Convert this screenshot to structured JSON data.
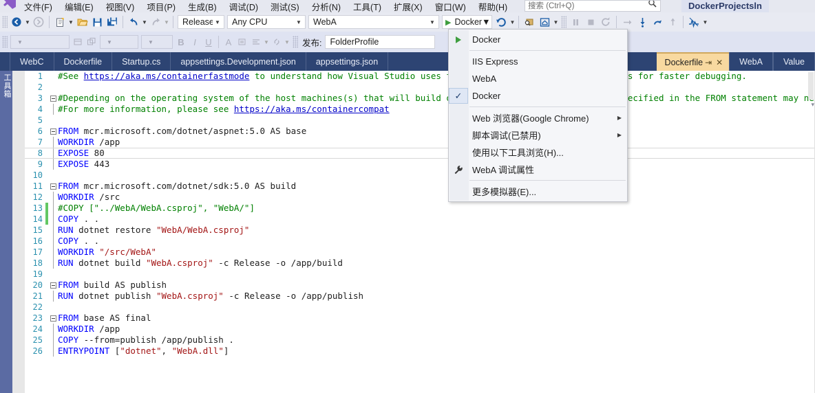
{
  "menubar": {
    "items": [
      {
        "label": "文件(F)"
      },
      {
        "label": "编辑(E)"
      },
      {
        "label": "视图(V)"
      },
      {
        "label": "项目(P)"
      },
      {
        "label": "生成(B)"
      },
      {
        "label": "调试(D)"
      },
      {
        "label": "测试(S)"
      },
      {
        "label": "分析(N)"
      },
      {
        "label": "工具(T)"
      },
      {
        "label": "扩展(X)"
      },
      {
        "label": "窗口(W)"
      },
      {
        "label": "帮助(H)"
      }
    ],
    "search_placeholder": "搜索 (Ctrl+Q)",
    "solution_title": "DockerProjectsln"
  },
  "toolbar": {
    "configuration": "Release",
    "platform": "Any CPU",
    "startup_project": "WebA",
    "run_target": "Docker",
    "publish_label": "发布:",
    "publish_profile": "FolderProfile"
  },
  "tabs": {
    "left": [
      {
        "label": "WebC"
      },
      {
        "label": "Dockerfile"
      },
      {
        "label": "Startup.cs"
      },
      {
        "label": "appsettings.Development.json"
      },
      {
        "label": "appsettings.json"
      }
    ],
    "right": [
      {
        "label": "Dockerfile",
        "active": true
      },
      {
        "label": "WebA",
        "active": false
      },
      {
        "label": "Value",
        "active": false
      }
    ],
    "pin_icon": "pin-icon",
    "close_icon": "close-icon"
  },
  "toolbox_rail_label": "工具箱",
  "dropdown": {
    "items": [
      {
        "label": "Docker",
        "icon": "play-icon",
        "type": "item"
      },
      {
        "type": "separator"
      },
      {
        "label": "IIS Express",
        "icon": "",
        "type": "item"
      },
      {
        "label": "WebA",
        "icon": "",
        "type": "item"
      },
      {
        "label": "Docker",
        "icon": "check-icon",
        "type": "item",
        "checked": true
      },
      {
        "type": "separator"
      },
      {
        "label": "Web 浏览器(Google Chrome)",
        "icon": "",
        "type": "item",
        "submenu": true
      },
      {
        "label": "脚本调试(已禁用)",
        "icon": "",
        "type": "item",
        "submenu": true
      },
      {
        "label": "使用以下工具浏览(H)...",
        "icon": "",
        "type": "item"
      },
      {
        "label": "WebA 调试属性",
        "icon": "wrench-icon",
        "type": "item"
      },
      {
        "type": "separator"
      },
      {
        "label": "更多模拟器(E)...",
        "icon": "",
        "type": "item"
      }
    ]
  },
  "editor": {
    "filename": "Dockerfile",
    "lines": [
      {
        "n": 1,
        "fold": "none",
        "change": "",
        "current": false,
        "spans": [
          {
            "t": "#See ",
            "c": "c-comment"
          },
          {
            "t": "https://aka.ms/containerfastmode",
            "c": "c-link"
          },
          {
            "t": " to understand how Visual Studio uses this Dockerfile to build your images for faster debugging.",
            "c": "c-comment"
          }
        ]
      },
      {
        "n": 2,
        "fold": "none",
        "change": "",
        "current": false,
        "spans": []
      },
      {
        "n": 3,
        "fold": "open",
        "change": "",
        "current": false,
        "spans": [
          {
            "t": "#Depending on the operating system of the host machines(s) that will build or run the containers, the image specified in the FROM statement may need to be changed.",
            "c": "c-comment"
          }
        ]
      },
      {
        "n": 4,
        "fold": "bar",
        "change": "",
        "current": false,
        "spans": [
          {
            "t": "#For more information, please see ",
            "c": "c-comment"
          },
          {
            "t": "https://aka.ms/containercompat",
            "c": "c-link"
          }
        ]
      },
      {
        "n": 5,
        "fold": "none",
        "change": "",
        "current": false,
        "spans": []
      },
      {
        "n": 6,
        "fold": "open",
        "change": "",
        "current": false,
        "spans": [
          {
            "t": "FROM",
            "c": "c-kw"
          },
          {
            "t": " mcr.microsoft.com/dotnet/aspnet:5.0 AS base",
            "c": "c-plain"
          }
        ]
      },
      {
        "n": 7,
        "fold": "bar",
        "change": "",
        "current": false,
        "spans": [
          {
            "t": "WORKDIR",
            "c": "c-kw"
          },
          {
            "t": " /app",
            "c": "c-plain"
          }
        ]
      },
      {
        "n": 8,
        "fold": "bar",
        "change": "",
        "current": true,
        "spans": [
          {
            "t": "EXPOSE",
            "c": "c-kw"
          },
          {
            "t": " 80",
            "c": "c-plain"
          }
        ]
      },
      {
        "n": 9,
        "fold": "bar",
        "change": "",
        "current": false,
        "spans": [
          {
            "t": "EXPOSE",
            "c": "c-kw"
          },
          {
            "t": " 443",
            "c": "c-plain"
          }
        ]
      },
      {
        "n": 10,
        "fold": "none",
        "change": "",
        "current": false,
        "spans": []
      },
      {
        "n": 11,
        "fold": "open",
        "change": "",
        "current": false,
        "spans": [
          {
            "t": "FROM",
            "c": "c-kw"
          },
          {
            "t": " mcr.microsoft.com/dotnet/sdk:5.0 AS build",
            "c": "c-plain"
          }
        ]
      },
      {
        "n": 12,
        "fold": "bar",
        "change": "",
        "current": false,
        "spans": [
          {
            "t": "WORKDIR",
            "c": "c-kw"
          },
          {
            "t": " /src",
            "c": "c-plain"
          }
        ]
      },
      {
        "n": 13,
        "fold": "bar",
        "change": "green",
        "current": false,
        "spans": [
          {
            "t": "#COPY [\"../WebA/WebA.csproj\", \"WebA/\"]",
            "c": "c-comment"
          }
        ]
      },
      {
        "n": 14,
        "fold": "bar",
        "change": "green",
        "current": false,
        "spans": [
          {
            "t": "COPY",
            "c": "c-kw"
          },
          {
            "t": " . .",
            "c": "c-plain"
          }
        ]
      },
      {
        "n": 15,
        "fold": "bar",
        "change": "",
        "current": false,
        "spans": [
          {
            "t": "RUN",
            "c": "c-kw"
          },
          {
            "t": " dotnet restore ",
            "c": "c-plain"
          },
          {
            "t": "\"WebA/WebA.csproj\"",
            "c": "c-str"
          }
        ]
      },
      {
        "n": 16,
        "fold": "bar",
        "change": "",
        "current": false,
        "spans": [
          {
            "t": "COPY",
            "c": "c-kw"
          },
          {
            "t": " . .",
            "c": "c-plain"
          }
        ]
      },
      {
        "n": 17,
        "fold": "bar",
        "change": "",
        "current": false,
        "spans": [
          {
            "t": "WORKDIR",
            "c": "c-kw"
          },
          {
            "t": " ",
            "c": "c-plain"
          },
          {
            "t": "\"/src/WebA\"",
            "c": "c-str"
          }
        ]
      },
      {
        "n": 18,
        "fold": "bar",
        "change": "",
        "current": false,
        "spans": [
          {
            "t": "RUN",
            "c": "c-kw"
          },
          {
            "t": " dotnet build ",
            "c": "c-plain"
          },
          {
            "t": "\"WebA.csproj\"",
            "c": "c-str"
          },
          {
            "t": " -c Release -o /app/build",
            "c": "c-plain"
          }
        ]
      },
      {
        "n": 19,
        "fold": "none",
        "change": "",
        "current": false,
        "spans": []
      },
      {
        "n": 20,
        "fold": "open",
        "change": "",
        "current": false,
        "spans": [
          {
            "t": "FROM",
            "c": "c-kw"
          },
          {
            "t": " build AS publish",
            "c": "c-plain"
          }
        ]
      },
      {
        "n": 21,
        "fold": "bar",
        "change": "",
        "current": false,
        "spans": [
          {
            "t": "RUN",
            "c": "c-kw"
          },
          {
            "t": " dotnet publish ",
            "c": "c-plain"
          },
          {
            "t": "\"WebA.csproj\"",
            "c": "c-str"
          },
          {
            "t": " -c Release -o /app/publish",
            "c": "c-plain"
          }
        ]
      },
      {
        "n": 22,
        "fold": "none",
        "change": "",
        "current": false,
        "spans": []
      },
      {
        "n": 23,
        "fold": "open",
        "change": "",
        "current": false,
        "spans": [
          {
            "t": "FROM",
            "c": "c-kw"
          },
          {
            "t": " base AS final",
            "c": "c-plain"
          }
        ]
      },
      {
        "n": 24,
        "fold": "bar",
        "change": "",
        "current": false,
        "spans": [
          {
            "t": "WORKDIR",
            "c": "c-kw"
          },
          {
            "t": " /app",
            "c": "c-plain"
          }
        ]
      },
      {
        "n": 25,
        "fold": "bar",
        "change": "",
        "current": false,
        "spans": [
          {
            "t": "COPY",
            "c": "c-kw"
          },
          {
            "t": " --from=publish /app/publish .",
            "c": "c-plain"
          }
        ]
      },
      {
        "n": 26,
        "fold": "bar",
        "change": "",
        "current": false,
        "spans": [
          {
            "t": "ENTRYPOINT",
            "c": "c-kw"
          },
          {
            "t": " [",
            "c": "c-plain"
          },
          {
            "t": "\"dotnet\"",
            "c": "c-str"
          },
          {
            "t": ", ",
            "c": "c-plain"
          },
          {
            "t": "\"WebA.dll\"",
            "c": "c-str"
          },
          {
            "t": "]",
            "c": "c-plain"
          }
        ]
      }
    ]
  },
  "colors": {
    "tabstrip_bg": "#2d4473",
    "active_tab_bg": "#f8d9a0",
    "toolbar_bg": "#e8eaf2",
    "toolbar2_bg": "#dfe3f2",
    "rail_bg": "#5b6ba3",
    "accent_green": "#3f9e3f",
    "change_marker": "#64c864"
  }
}
